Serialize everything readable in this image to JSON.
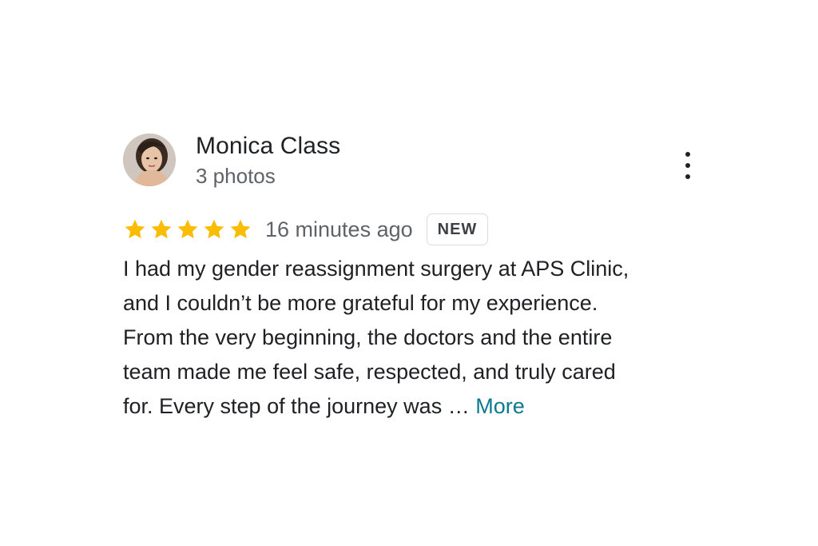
{
  "review": {
    "author_name": "Monica Class",
    "photo_count": "3 photos",
    "rating": 5,
    "rating_max": 5,
    "timestamp": "16 minutes ago",
    "badge": "NEW",
    "text_lines": [
      "I had my gender reassignment surgery at APS Clinic,",
      "and I couldn’t be more grateful for my experience.",
      "From the very beginning, the doctors and the entire",
      "team made me feel safe, respected, and truly cared",
      "for. Every step of the journey was … "
    ],
    "more_label": "More"
  },
  "icons": {
    "star": "star-icon",
    "menu": "more-vert-icon"
  },
  "colors": {
    "star": "#fbbc04",
    "link": "#0b7a8f",
    "secondary_text": "#5f6368",
    "badge_border": "#dadce0"
  }
}
